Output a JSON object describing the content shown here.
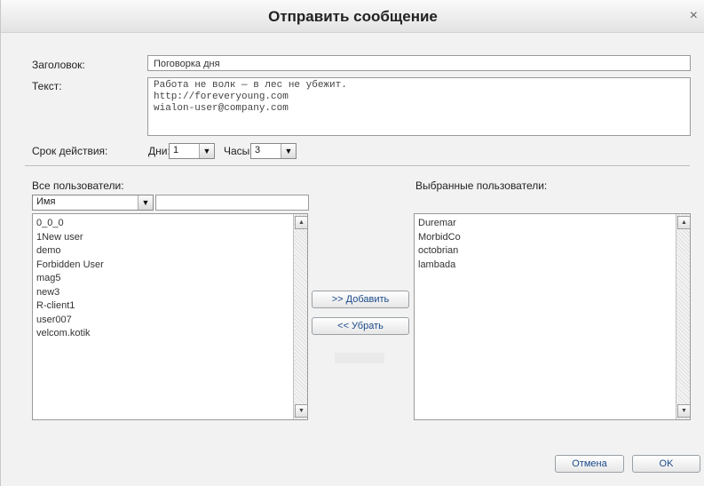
{
  "dialog": {
    "title": "Отправить сообщение",
    "close_glyph": "×"
  },
  "form": {
    "header_label": "Заголовок:",
    "header_value": "Поговорка дня",
    "text_label": "Текст:",
    "text_value": "Работа не волк — в лес не убежит.\nhttp://foreveryoung.com\nwialon-user@company.com",
    "validity_label": "Срок действия:",
    "days_label": "Дни:",
    "days_value": "1",
    "hours_label": "Часы:",
    "hours_value": "3"
  },
  "all_users": {
    "label": "Все пользователи:",
    "filter_select_value": "Имя",
    "filter_input_value": "",
    "items": [
      "0_0_0",
      "1New user",
      "demo",
      "Forbidden User",
      "mag5",
      "new3",
      "R-client1",
      "user007",
      "velcom.kotik"
    ]
  },
  "selected_users": {
    "label": "Выбранные пользователи:",
    "items": [
      "Duremar",
      "MorbidCo",
      "octobrian",
      "lambada"
    ]
  },
  "actions": {
    "add_label": ">> Добавить",
    "remove_label": "<< Убрать",
    "cancel_label": "Отмена",
    "ok_label": "OK"
  },
  "icons": {
    "dropdown_arrow": "▼",
    "scroll_up": "▲",
    "scroll_down": "▼"
  }
}
